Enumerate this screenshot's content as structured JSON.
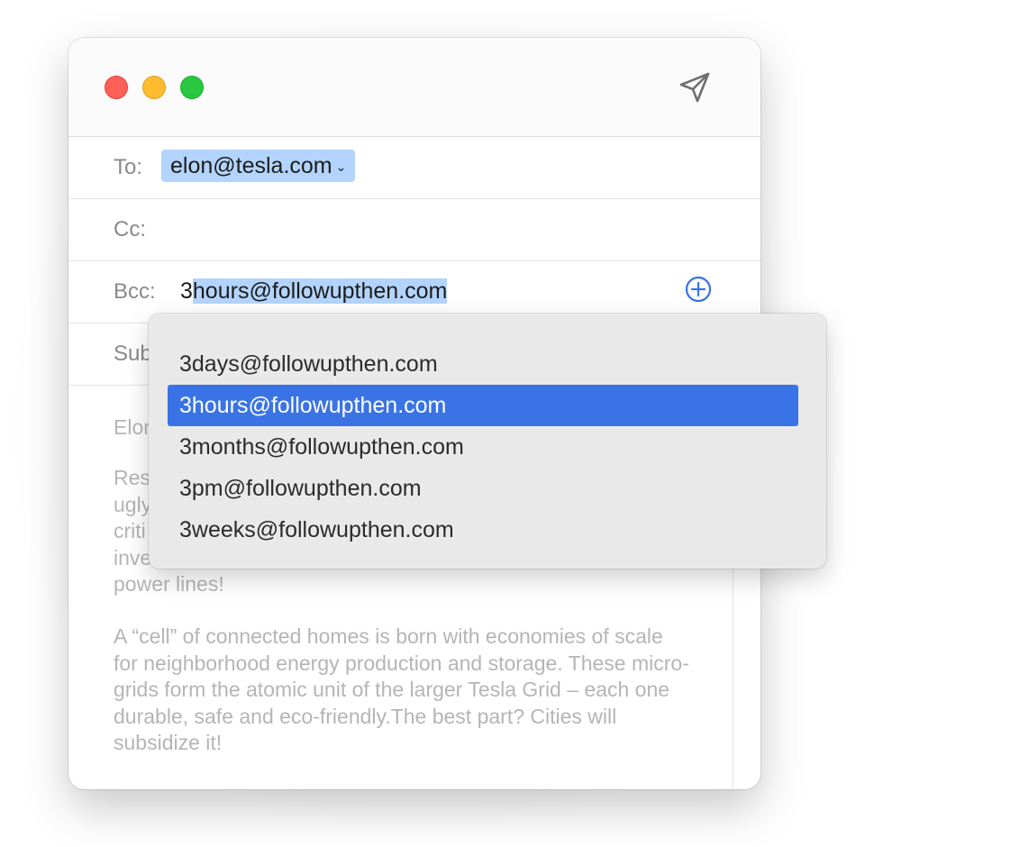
{
  "titlebar": {
    "send_icon": "paper-plane-icon"
  },
  "header": {
    "to_label": "To:",
    "to_recipient": "elon@tesla.com",
    "cc_label": "Cc:",
    "bcc_label": "Bcc:",
    "bcc_typed": "3",
    "bcc_autocomplete": "hours@followupthen.com",
    "subject_label_visible": "Sub"
  },
  "body": {
    "greeting_visible": "Elon",
    "paragraph1_visible": [
      "Res",
      "ugly",
      "criti",
      "inve",
      "power lines!"
    ],
    "paragraph2": "A “cell” of connected homes is born with economies of scale for neighborhood energy production and storage. These micro-grids form the atomic unit of the larger Tesla Grid – each one durable, safe and eco-friendly.The best part? Cities will subsidize it!"
  },
  "autocomplete": {
    "items": [
      {
        "label": "3days@followupthen.com",
        "selected": false
      },
      {
        "label": "3hours@followupthen.com",
        "selected": true
      },
      {
        "label": "3months@followupthen.com",
        "selected": false
      },
      {
        "label": "3pm@followupthen.com",
        "selected": false
      },
      {
        "label": "3weeks@followupthen.com",
        "selected": false
      }
    ]
  },
  "colors": {
    "selection_highlight": "#b3d4fc",
    "menu_selected": "#3a73e6",
    "close": "#fe5f57",
    "minimize": "#febc2e",
    "zoom": "#28c840",
    "accent_icon": "#3a73e6"
  }
}
